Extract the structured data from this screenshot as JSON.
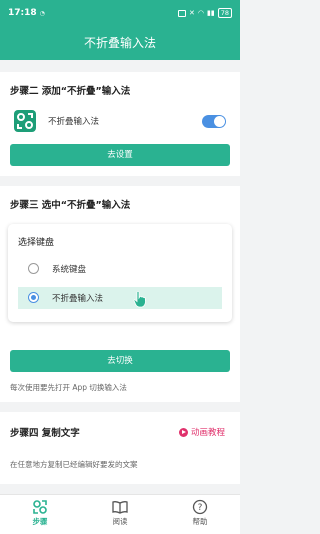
{
  "status": {
    "time": "17:18",
    "battery": "78"
  },
  "header": {
    "title": "不折叠输入法"
  },
  "step2": {
    "title": "步骤二 添加“不折叠”输入法",
    "app_name": "不折叠输入法",
    "toggle_on": true,
    "button": "去设置"
  },
  "step3": {
    "title": "步骤三 选中“不折叠”输入法",
    "picker_title": "选择键盘",
    "options": [
      {
        "label": "系统键盘",
        "selected": false
      },
      {
        "label": "不折叠输入法",
        "selected": true
      }
    ],
    "button": "去切换",
    "hint": "每次使用要先打开 App 切换输入法"
  },
  "step4": {
    "title": "步骤四 复制文字",
    "tutorial": "动画教程",
    "hint": "在任意地方复制已经编辑好要发的文案"
  },
  "tabs": [
    {
      "label": "步骤",
      "active": true,
      "icon": "steps-icon"
    },
    {
      "label": "阅读",
      "active": false,
      "icon": "book-icon"
    },
    {
      "label": "帮助",
      "active": false,
      "icon": "help-icon"
    }
  ],
  "colors": {
    "accent": "#2ab291",
    "toggle": "#4a90e2",
    "tutorial": "#e0316c",
    "selected_bg": "#dbf3ec"
  }
}
